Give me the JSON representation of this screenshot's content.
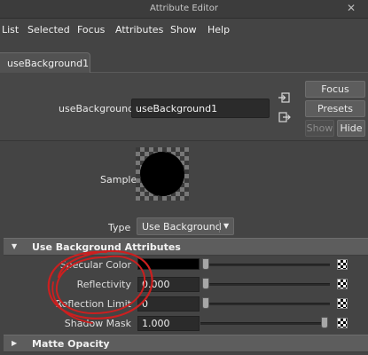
{
  "window": {
    "title": "Attribute Editor"
  },
  "menu": {
    "items": [
      {
        "label": "List"
      },
      {
        "label": "Selected"
      },
      {
        "label": "Focus"
      },
      {
        "label": "Attributes"
      },
      {
        "label": "Show"
      },
      {
        "label": "Help"
      }
    ]
  },
  "tabs": [
    {
      "label": "useBackground1",
      "active": true
    }
  ],
  "node": {
    "type_label": "useBackground:",
    "name_value": "useBackground1"
  },
  "buttons": {
    "focus": "Focus",
    "presets": "Presets",
    "show": "Show",
    "hide": "Hide"
  },
  "sample": {
    "label": "Sample"
  },
  "type_field": {
    "label": "Type",
    "value": "Use Background"
  },
  "sections": {
    "use_background": {
      "title": "Use Background Attributes",
      "expanded": true,
      "rows": [
        {
          "label": "Specular Color",
          "value": "",
          "swatch_color": "#000000",
          "slider_fraction": 0.0
        },
        {
          "label": "Reflectivity",
          "value": "0.000",
          "slider_fraction": 0.0
        },
        {
          "label": "Reflection Limit",
          "value": "0",
          "slider_fraction": 0.0
        },
        {
          "label": "Shadow Mask",
          "value": "1.000",
          "slider_fraction": 1.0
        }
      ]
    },
    "matte_opacity": {
      "title": "Matte Opacity",
      "expanded": false
    }
  },
  "colors": {
    "background": "#444444",
    "field": "#2b2b2b",
    "section_header": "#5d5d5d",
    "annotation": "#cc1f1f"
  },
  "icons": [
    "close-icon",
    "input-connection-icon",
    "output-connection-icon",
    "expand-arrow-icon",
    "collapse-arrow-icon",
    "map-texture-icon"
  ]
}
